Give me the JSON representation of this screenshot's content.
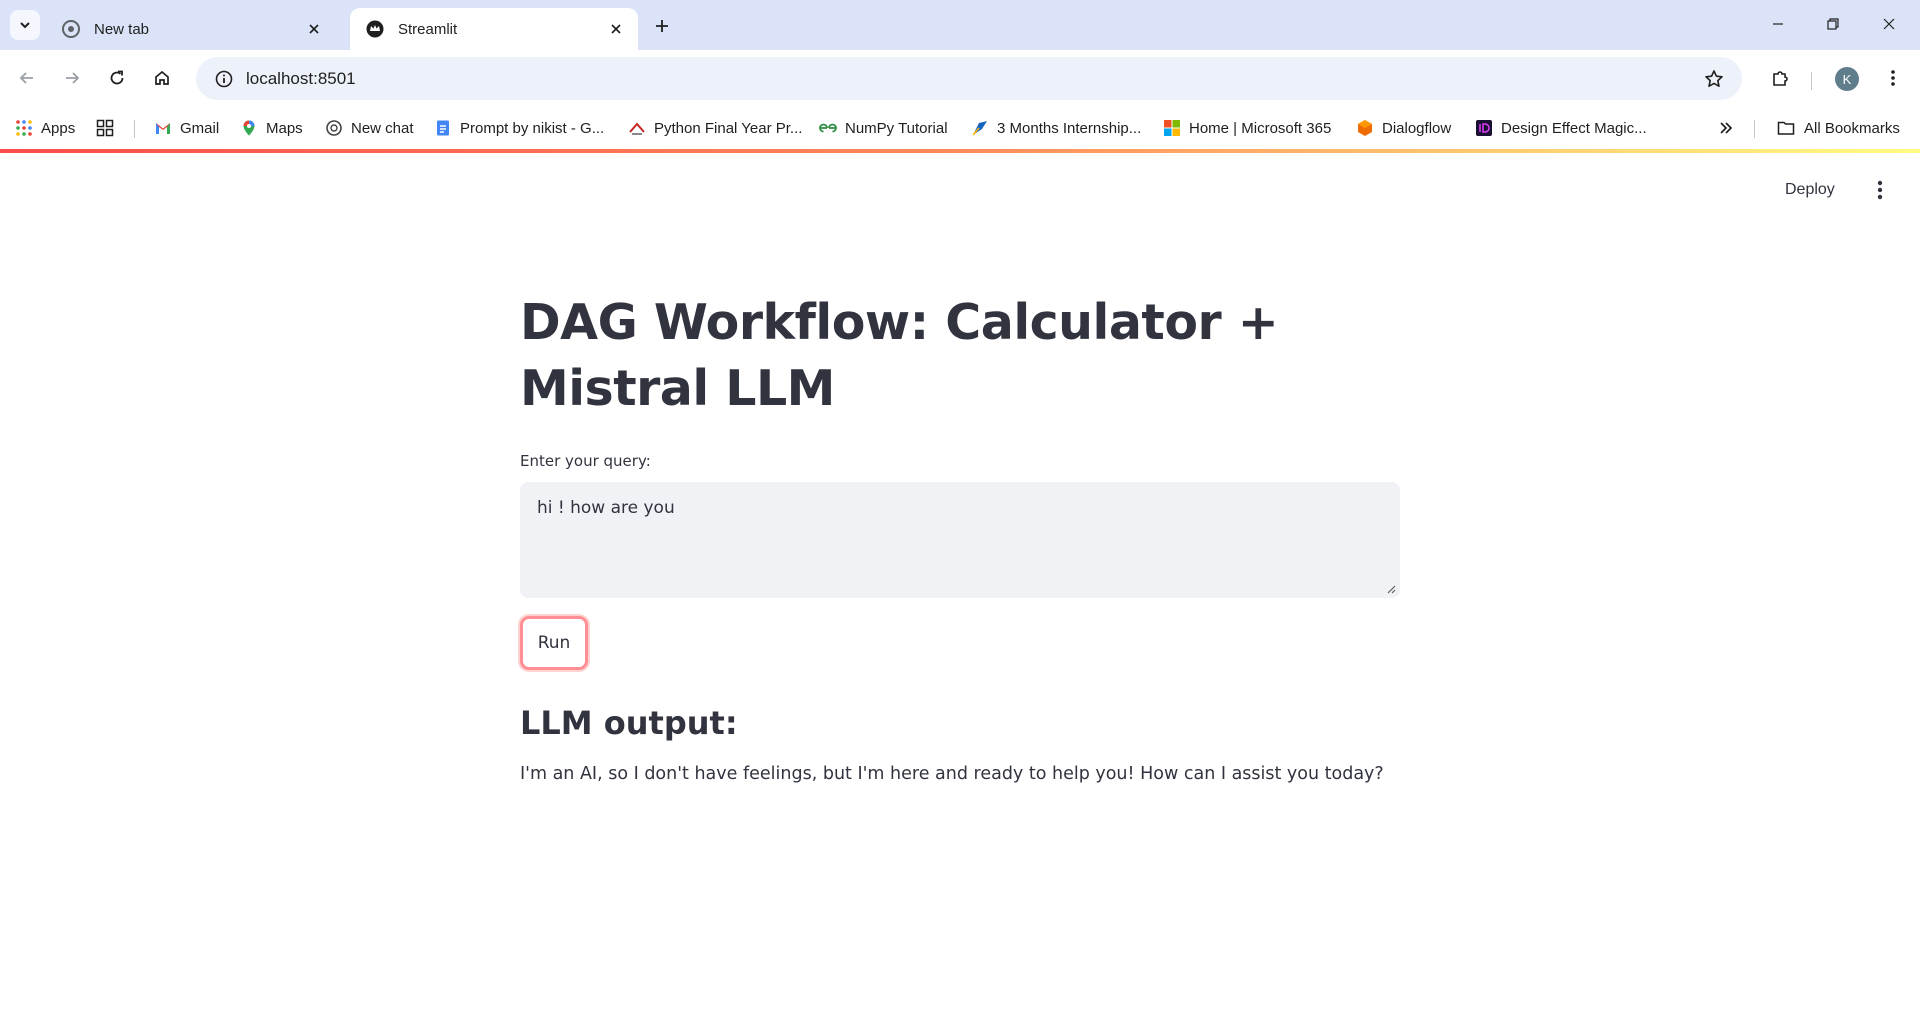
{
  "browser": {
    "tabs": [
      {
        "title": "New tab",
        "favicon": "chrome-icon",
        "active": false
      },
      {
        "title": "Streamlit",
        "favicon": "streamlit-crown-icon",
        "active": true
      }
    ],
    "url": "localhost:8501",
    "profile_initial": "K"
  },
  "bookmarks": {
    "items": [
      {
        "label": "Apps",
        "icon": "apps-grid-icon"
      },
      {
        "label": "",
        "icon": "tab-groups-icon"
      },
      {
        "label": "Gmail",
        "icon": "gmail-icon"
      },
      {
        "label": "Maps",
        "icon": "maps-icon"
      },
      {
        "label": "New chat",
        "icon": "openai-icon"
      },
      {
        "label": "Prompt by nikist - G...",
        "icon": "google-docs-icon"
      },
      {
        "label": "Python Final Year Pr...",
        "icon": "site-icon"
      },
      {
        "label": "NumPy Tutorial",
        "icon": "geeksforgeeks-icon"
      },
      {
        "label": "3 Months Internship...",
        "icon": "site-icon"
      },
      {
        "label": "Home | Microsoft 365",
        "icon": "microsoft-icon"
      },
      {
        "label": "Dialogflow",
        "icon": "dialogflow-icon"
      },
      {
        "label": "Design Effect Magic...",
        "icon": "design-icon"
      }
    ],
    "all_bookmarks_label": "All Bookmarks"
  },
  "app": {
    "deploy_label": "Deploy",
    "title": "DAG Workflow: Calculator + Mistral LLM",
    "query_label": "Enter your query:",
    "query_value": "hi ! how are you",
    "run_label": "Run",
    "output_heading": "LLM output:",
    "output_text": "I'm an AI, so I don't have feelings, but I'm here and ready to help you! How can I assist you today?"
  },
  "colors": {
    "tabstrip": "#dae3f7",
    "text": "#31333f",
    "input_bg": "#f0f2f6",
    "accent": "#ff4b4b"
  }
}
